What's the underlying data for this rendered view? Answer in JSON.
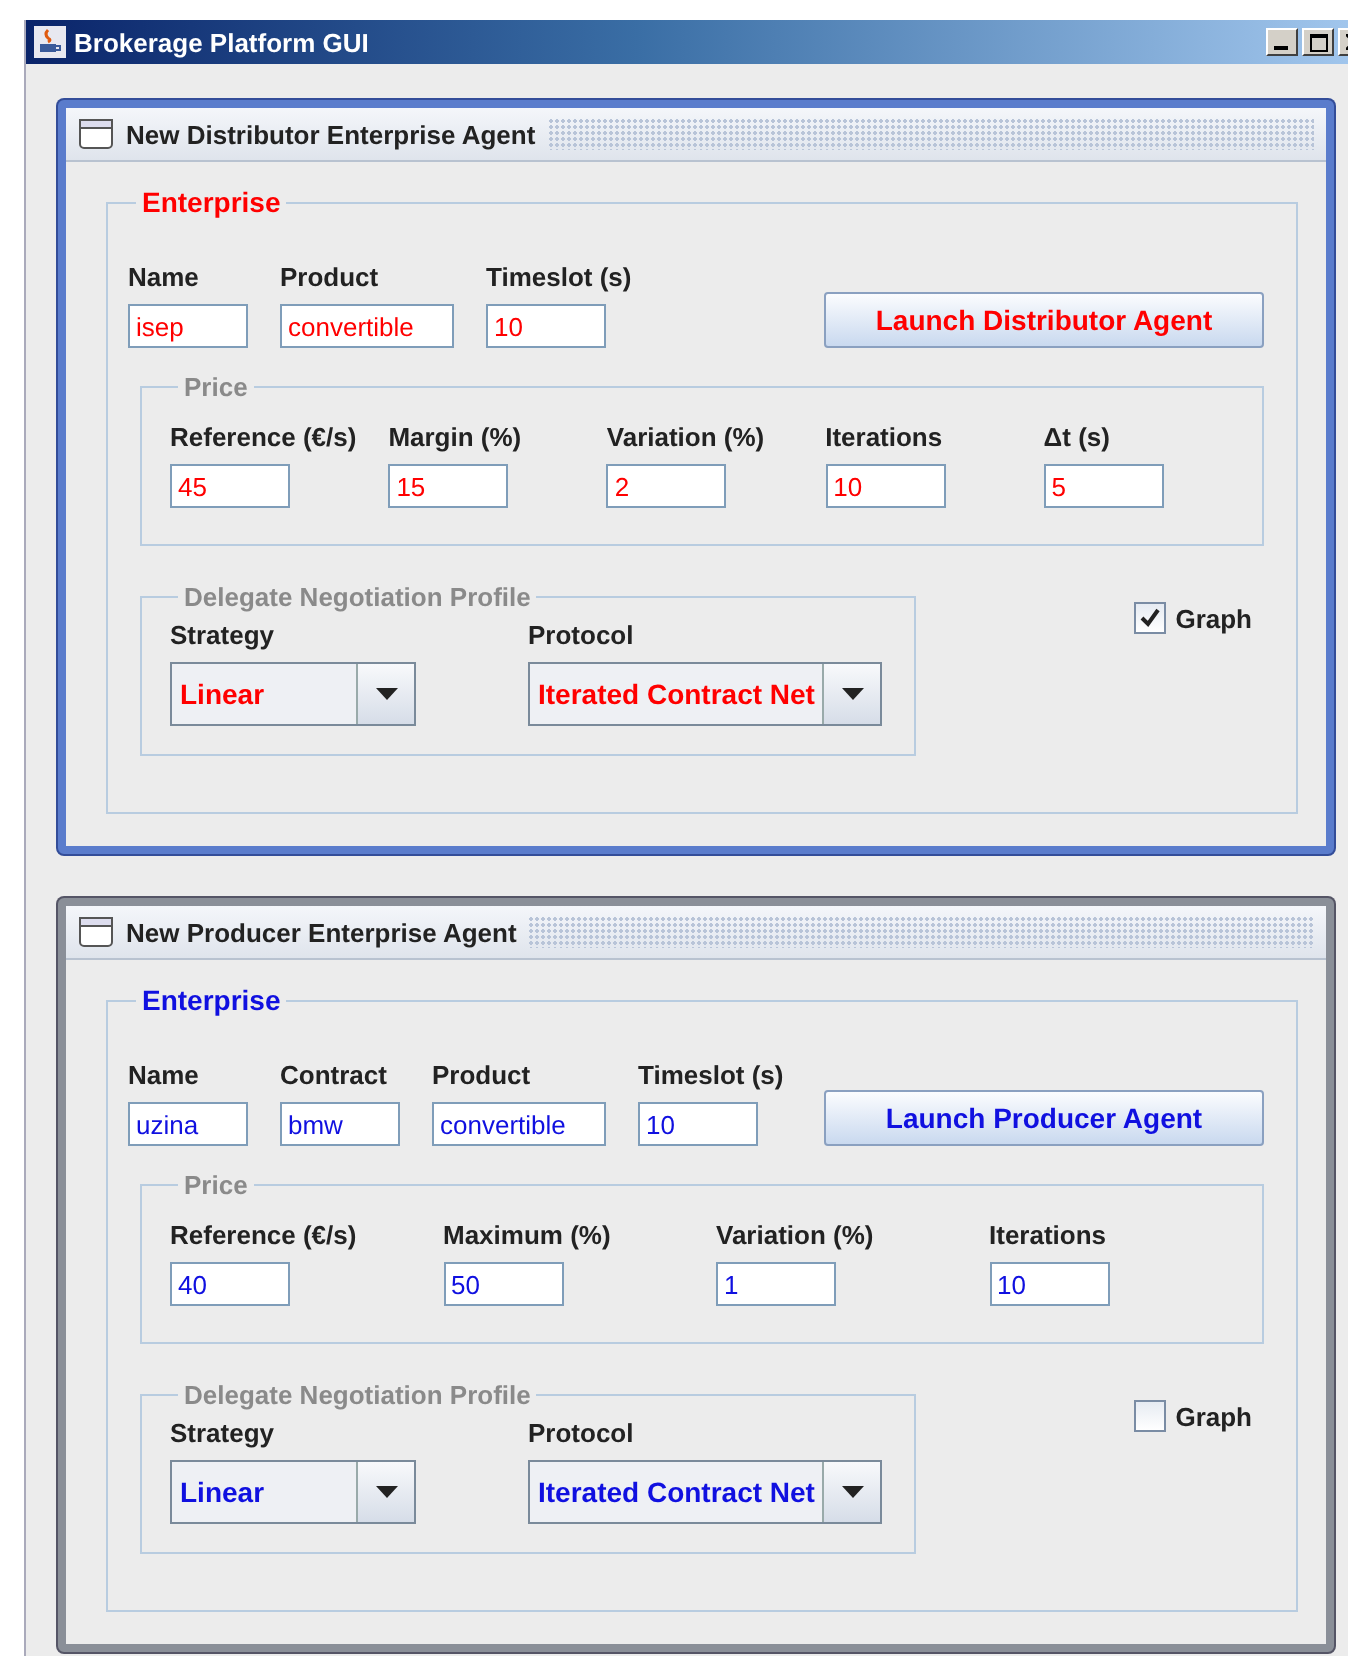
{
  "window": {
    "title": "Brokerage Platform GUI"
  },
  "frames": [
    {
      "title": "New Distributor Enterprise Agent",
      "active": true,
      "color": "#ff0000",
      "enterprise": {
        "legend": "Enterprise",
        "fields": [
          {
            "label": "Name",
            "value": "isep"
          },
          {
            "label": "Product",
            "value": "convertible"
          },
          {
            "label": "Timeslot (s)",
            "value": "10"
          }
        ],
        "button": "Launch Distributor Agent"
      },
      "price": {
        "legend": "Price",
        "fields": [
          {
            "label": "Reference (€/s)",
            "value": "45"
          },
          {
            "label": "Margin (%)",
            "value": "15"
          },
          {
            "label": "Variation (%)",
            "value": "2"
          },
          {
            "label": "Iterations",
            "value": "10"
          },
          {
            "label": "Δt (s)",
            "value": "5"
          }
        ]
      },
      "profile": {
        "legend": "Delegate Negotiation Profile",
        "selects": [
          {
            "label": "Strategy",
            "value": "Linear"
          },
          {
            "label": "Protocol",
            "value": "Iterated Contract Net"
          }
        ]
      },
      "graph": {
        "label": "Graph",
        "checked": true
      }
    },
    {
      "title": "New Producer Enterprise Agent",
      "active": false,
      "color": "#1010e0",
      "enterprise": {
        "legend": "Enterprise",
        "fields": [
          {
            "label": "Name",
            "value": "uzina"
          },
          {
            "label": "Contract",
            "value": "bmw"
          },
          {
            "label": "Product",
            "value": "convertible"
          },
          {
            "label": "Timeslot (s)",
            "value": "10"
          }
        ],
        "button": "Launch Producer Agent"
      },
      "price": {
        "legend": "Price",
        "fields": [
          {
            "label": "Reference (€/s)",
            "value": "40"
          },
          {
            "label": "Maximum (%)",
            "value": "50"
          },
          {
            "label": "Variation (%)",
            "value": "1"
          },
          {
            "label": "Iterations",
            "value": "10"
          }
        ]
      },
      "profile": {
        "legend": "Delegate Negotiation Profile",
        "selects": [
          {
            "label": "Strategy",
            "value": "Linear"
          },
          {
            "label": "Protocol",
            "value": "Iterated Contract Net"
          }
        ]
      },
      "graph": {
        "label": "Graph",
        "checked": false
      }
    }
  ]
}
